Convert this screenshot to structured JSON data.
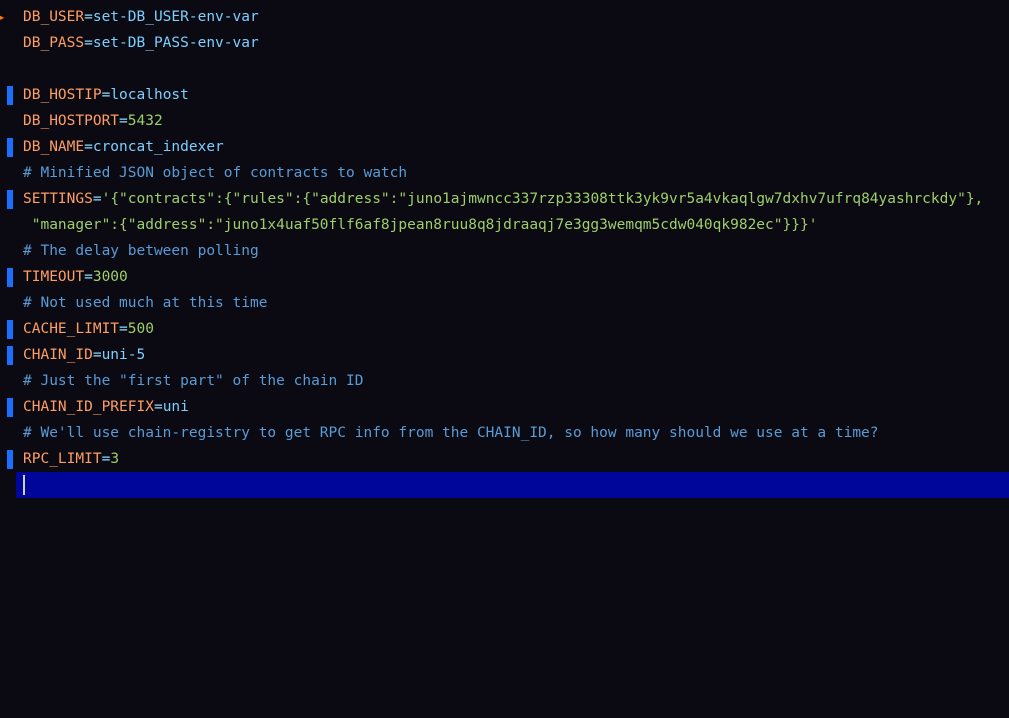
{
  "lines": [
    {
      "type": "assign",
      "var": "DB_USER",
      "value": "set-DB_USER-env-var",
      "marker": "arrow"
    },
    {
      "type": "assign",
      "var": "DB_PASS",
      "value": "set-DB_PASS-env-var",
      "marker": "none"
    },
    {
      "type": "blank"
    },
    {
      "type": "assign",
      "var": "DB_HOSTIP",
      "value": "localhost",
      "marker": "blue"
    },
    {
      "type": "assign-num",
      "var": "DB_HOSTPORT",
      "value": "5432",
      "marker": "none"
    },
    {
      "type": "assign",
      "var": "DB_NAME",
      "value": "croncat_indexer",
      "marker": "blue"
    },
    {
      "type": "comment",
      "text": "# Minified JSON object of contracts to watch",
      "marker": "none"
    },
    {
      "type": "assign-json",
      "var": "SETTINGS",
      "value_open": "'",
      "json": "{\"contracts\":{\"rules\":{\"address\":\"juno1ajmwncc337rzp33308ttk3yk9vr5a4vkaqlgw7dxhv7ufrq84yashrckdy\"},",
      "marker": "blue"
    },
    {
      "type": "json-cont",
      "json": " \"manager\":{\"address\":\"juno1x4uaf50flf6af8jpean8ruu8q8jdraaqj7e3gg3wemqm5cdw040qk982ec\"}}}",
      "close": "'",
      "marker": "none"
    },
    {
      "type": "comment",
      "text": "# The delay between polling",
      "marker": "none"
    },
    {
      "type": "assign-num",
      "var": "TIMEOUT",
      "value": "3000",
      "marker": "blue"
    },
    {
      "type": "comment",
      "text": "# Not used much at this time",
      "marker": "none"
    },
    {
      "type": "assign-num",
      "var": "CACHE_LIMIT",
      "value": "500",
      "marker": "blue"
    },
    {
      "type": "assign",
      "var": "CHAIN_ID",
      "value": "uni-5",
      "marker": "blue"
    },
    {
      "type": "comment",
      "text": "# Just the \"first part\" of the chain ID",
      "marker": "none"
    },
    {
      "type": "assign",
      "var": "CHAIN_ID_PREFIX",
      "value": "uni",
      "marker": "blue"
    },
    {
      "type": "comment",
      "text": "# We'll use chain-registry to get RPC info from the CHAIN_ID, so how many should we use at a time?",
      "marker": "none"
    },
    {
      "type": "assign-num",
      "var": "RPC_LIMIT",
      "value": "3",
      "marker": "blue"
    },
    {
      "type": "cursor"
    }
  ]
}
